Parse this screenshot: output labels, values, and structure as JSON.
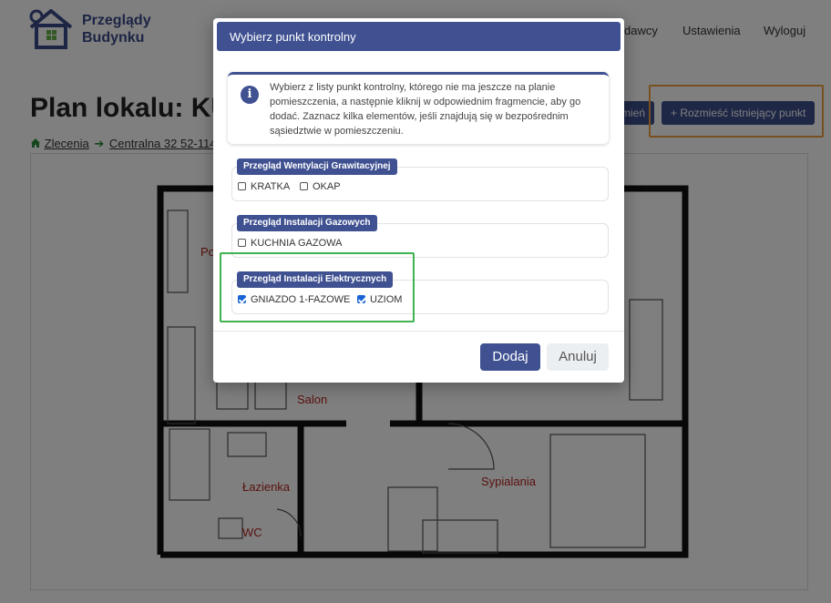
{
  "header": {
    "brand_line1": "Przeglądy",
    "brand_line2": "Budynku",
    "nav": {
      "partial": "dawcy",
      "settings": "Ustawienia",
      "logout": "Wyloguj"
    }
  },
  "page": {
    "title": "Plan lokalu: KU",
    "breadcrumb": {
      "orders": "Zlecenia",
      "address": "Centralna 32 52-114 W"
    },
    "buttons": {
      "partial_left": "mień",
      "place_existing": "+ Rozmieść istniejący punkt"
    }
  },
  "floor_plan": {
    "rooms": {
      "po": "Po",
      "salon": "Salon",
      "lazienka": "Łazienka",
      "wc": "WC",
      "sypialnia": "Sypialania"
    }
  },
  "modal": {
    "title": "Wybierz punkt kontrolny",
    "info_icon": "info-icon",
    "info_text": "Wybierz z listy punkt kontrolny, którego nie ma jeszcze na planie pomieszczenia, a następnie kliknij w odpowiednim fragmencie, aby go dodać. Zaznacz kilka elementów, jeśli znajdują się w bezpośrednim sąsiedztwie w pomieszczeniu.",
    "groups": [
      {
        "title": "Przegląd Wentylacji Grawitacyjnej",
        "items": [
          {
            "label": "KRATKA",
            "checked": false
          },
          {
            "label": "OKAP",
            "checked": false
          }
        ]
      },
      {
        "title": "Przegląd Instalacji Gazowych",
        "items": [
          {
            "label": "KUCHNIA GAZOWA",
            "checked": false
          }
        ]
      },
      {
        "title": "Przegląd Instalacji Elektrycznych",
        "items": [
          {
            "label": "GNIAZDO 1-FAZOWE",
            "checked": true
          },
          {
            "label": "UZIOM",
            "checked": true
          }
        ]
      }
    ],
    "buttons": {
      "add": "Dodaj",
      "cancel": "Anuluj"
    }
  },
  "colors": {
    "primary": "#3f5191",
    "highlight_orange": "#f0a040",
    "highlight_green": "#3fb34f",
    "checkbox": "#1a63d6"
  }
}
